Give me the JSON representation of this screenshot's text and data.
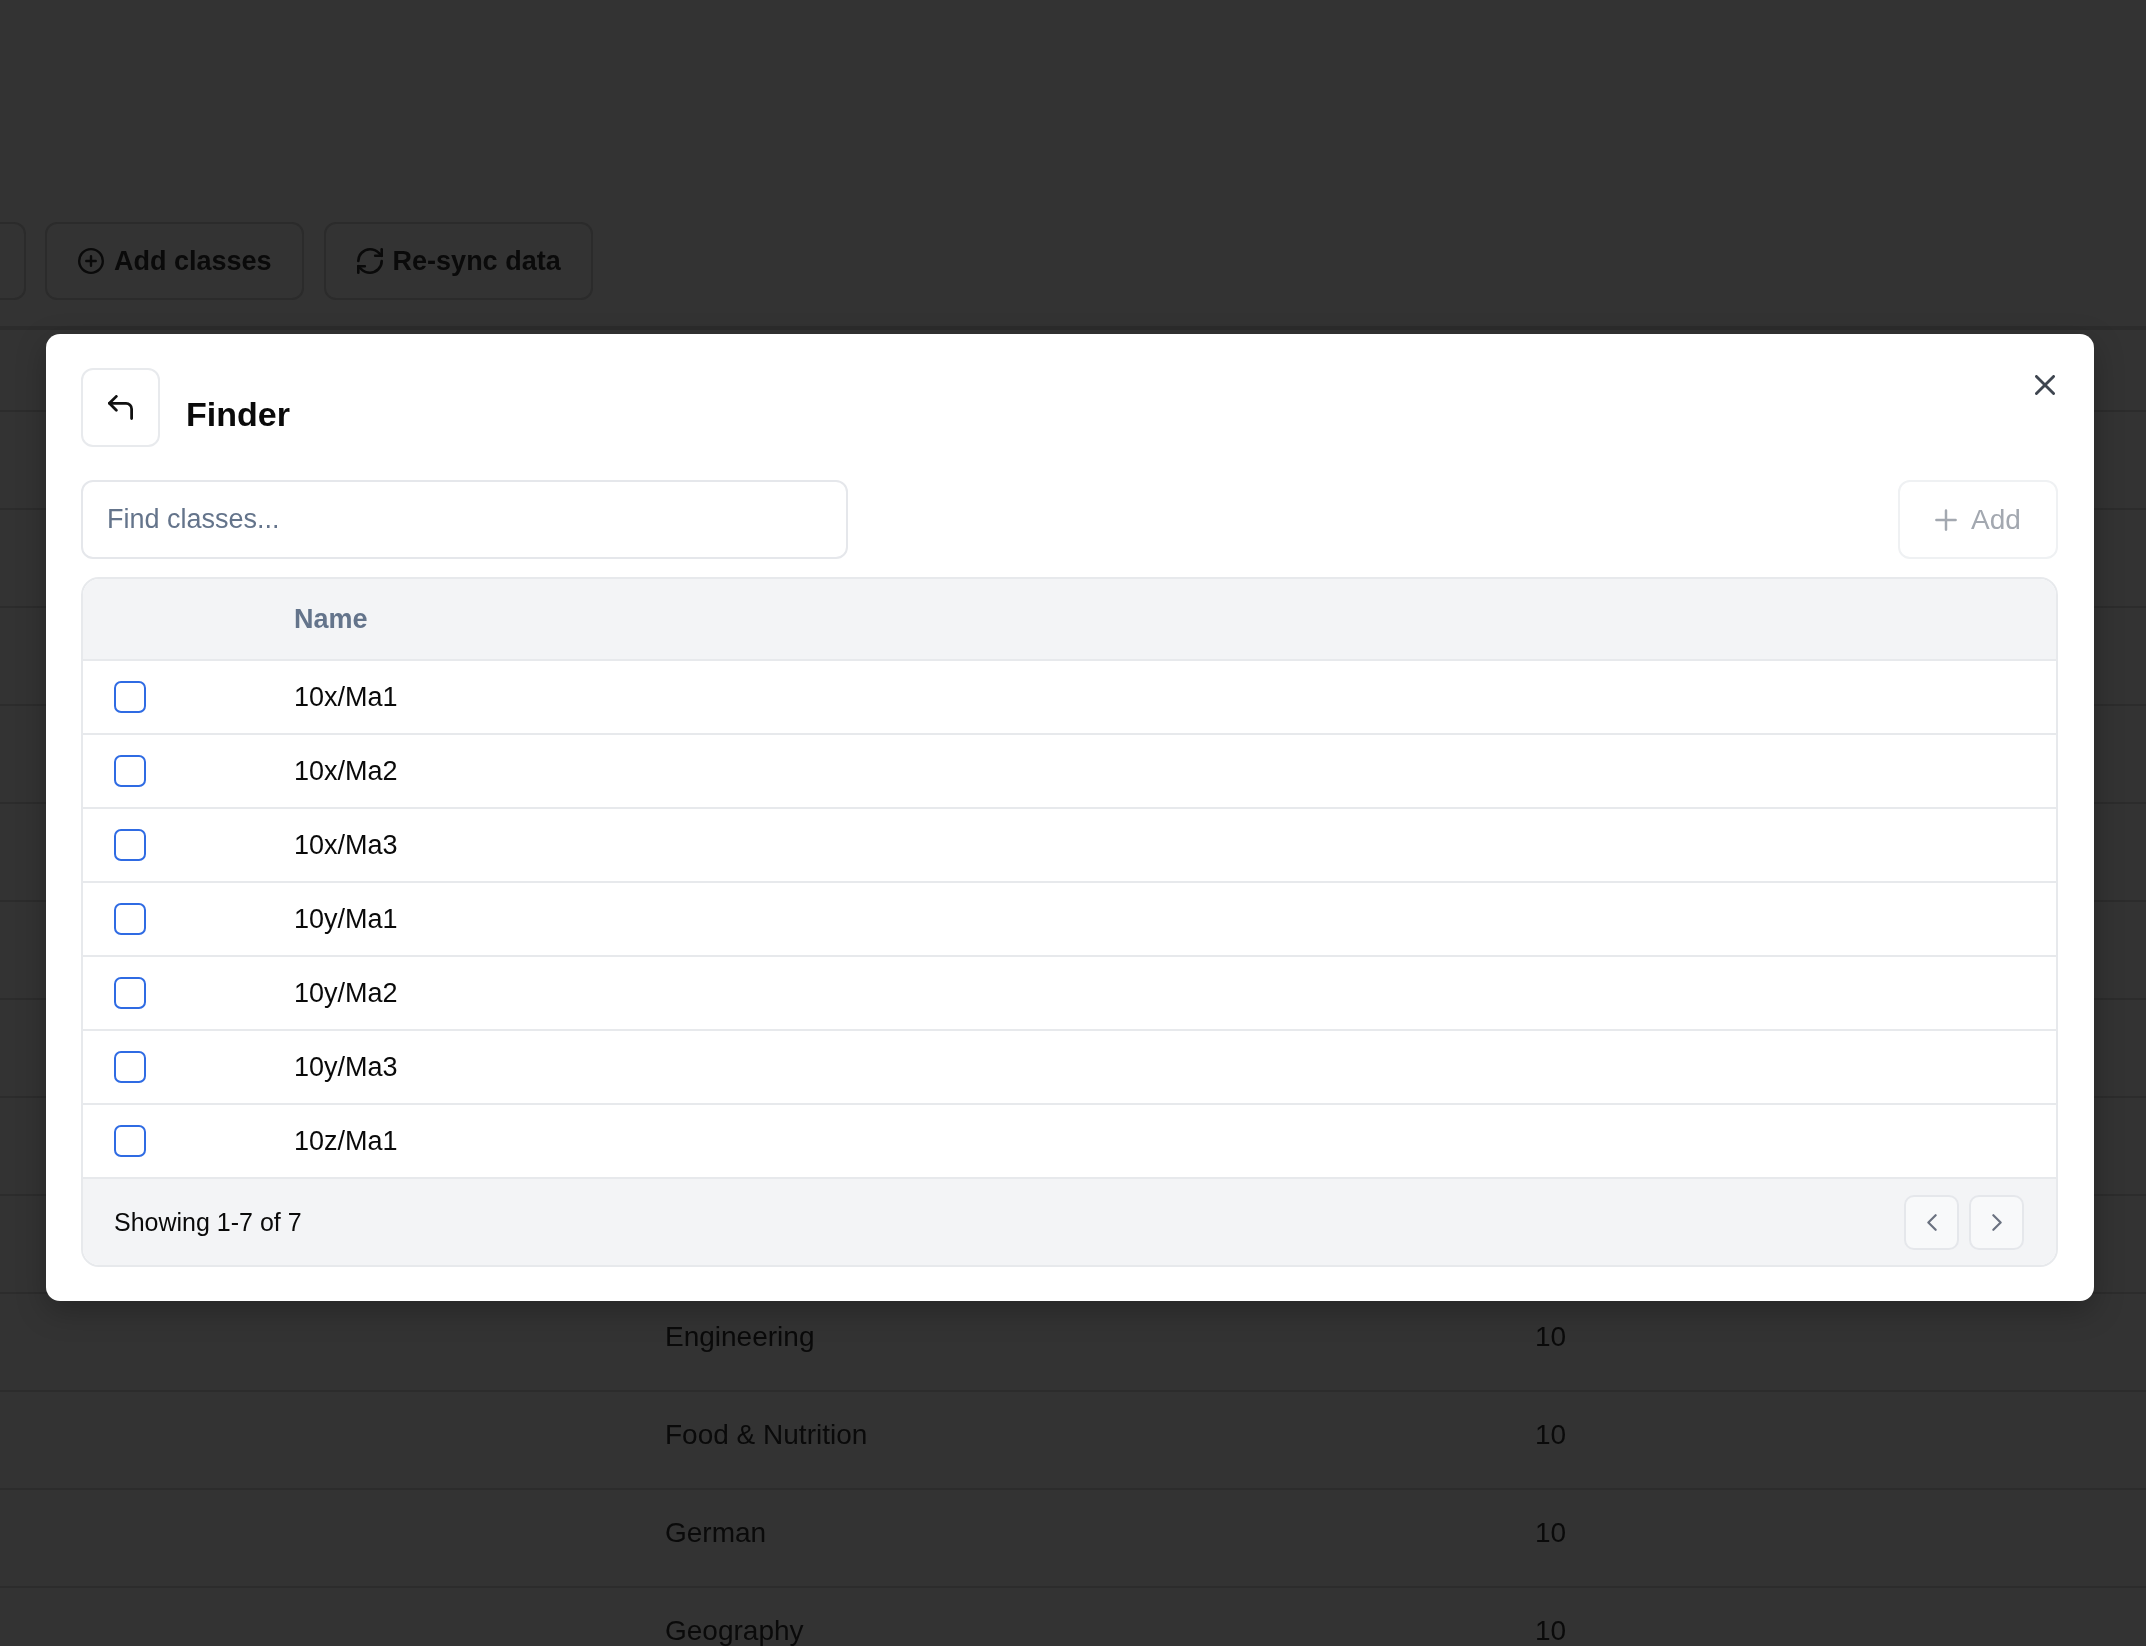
{
  "background": {
    "toolbar": [
      {
        "kind": "edge"
      },
      {
        "kind": "add",
        "label": "Add classes"
      },
      {
        "kind": "sync",
        "label": "Re-sync data"
      }
    ],
    "table": {
      "rows": [
        {
          "cells": [
            "Engineering",
            "10"
          ]
        },
        {
          "cells": [
            "Food & Nutrition",
            "10"
          ]
        },
        {
          "cells": [
            "German",
            "10"
          ]
        },
        {
          "cells": [
            "Geography",
            "10"
          ]
        }
      ]
    }
  },
  "dialog": {
    "title": "Finder",
    "search": {
      "placeholder": "Find classes..."
    },
    "add_button": {
      "label": "Add",
      "disabled": true
    },
    "table": {
      "columns": [
        {
          "label": "Name"
        }
      ],
      "rows": [
        {
          "name": "10x/Ma1",
          "checked": false
        },
        {
          "name": "10x/Ma2",
          "checked": false
        },
        {
          "name": "10x/Ma3",
          "checked": false
        },
        {
          "name": "10y/Ma1",
          "checked": false
        },
        {
          "name": "10y/Ma2",
          "checked": false
        },
        {
          "name": "10y/Ma3",
          "checked": false
        },
        {
          "name": "10z/Ma1",
          "checked": false
        }
      ]
    },
    "footer": {
      "summary": "Showing 1-7 of 7"
    }
  }
}
